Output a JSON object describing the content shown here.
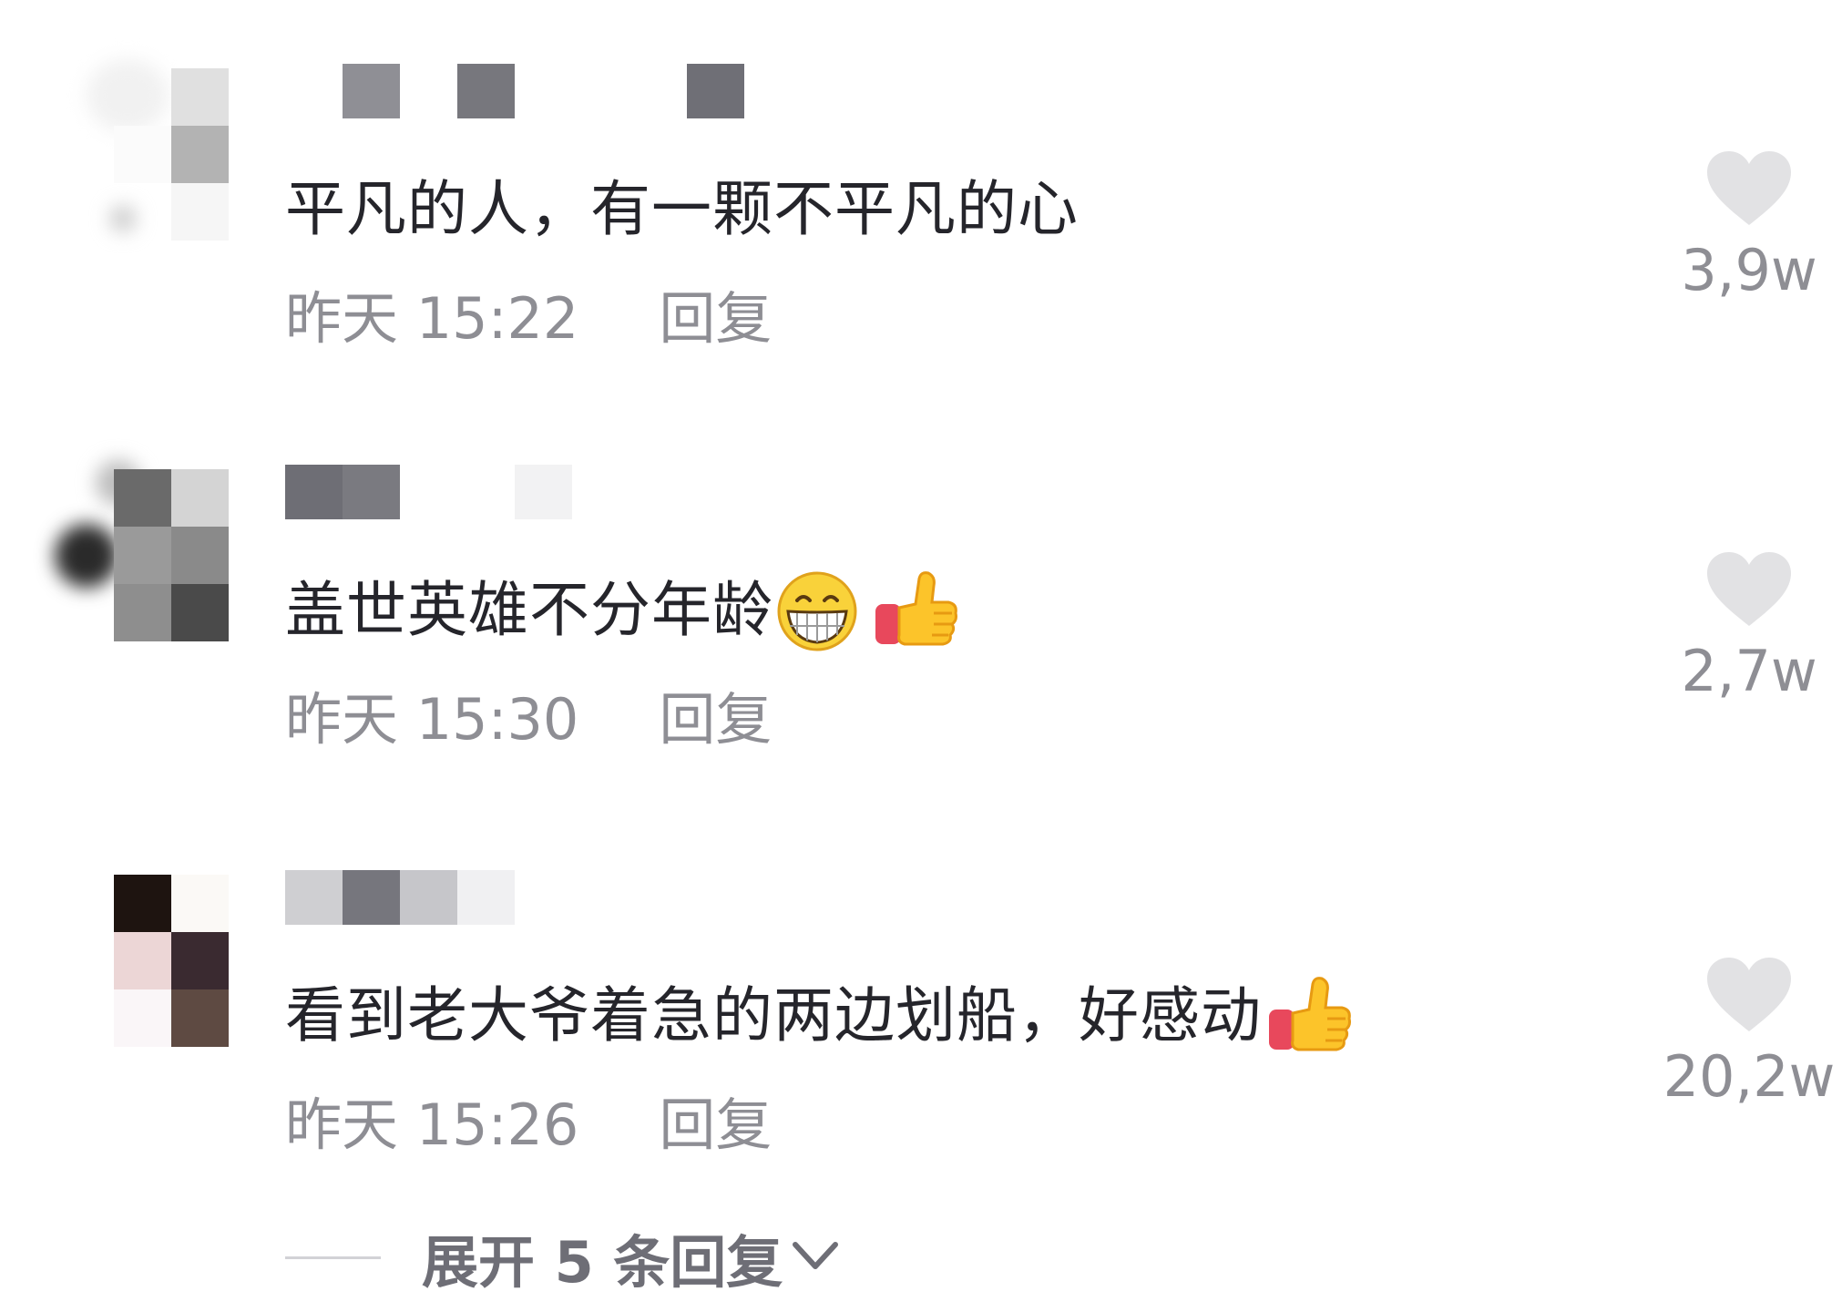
{
  "comments": [
    {
      "text": "平凡的人，有一颗不平凡的心",
      "time": "昨天 15:22",
      "reply_label": "回复",
      "likes": "3,9w",
      "emoji": []
    },
    {
      "text": "盖世英雄不分年龄",
      "time": "昨天 15:30",
      "reply_label": "回复",
      "likes": "2,7w",
      "emoji": [
        "grinning-face-emoji",
        "thumbs-up-emoji"
      ]
    },
    {
      "text": "看到老大爷着急的两边划船，好感动",
      "time": "昨天 15:26",
      "reply_label": "回复",
      "likes": "20,2w",
      "emoji": [
        "thumbs-up-emoji"
      ]
    }
  ],
  "expand_replies": {
    "label": "展开 5 条回复",
    "icon": "chevron-down-icon"
  },
  "colors": {
    "text": "#25252b",
    "secondary": "#8e8e94",
    "heart": "#e2e2e4",
    "expand": "#6e6e76"
  },
  "icons": {
    "like": "heart-icon"
  }
}
